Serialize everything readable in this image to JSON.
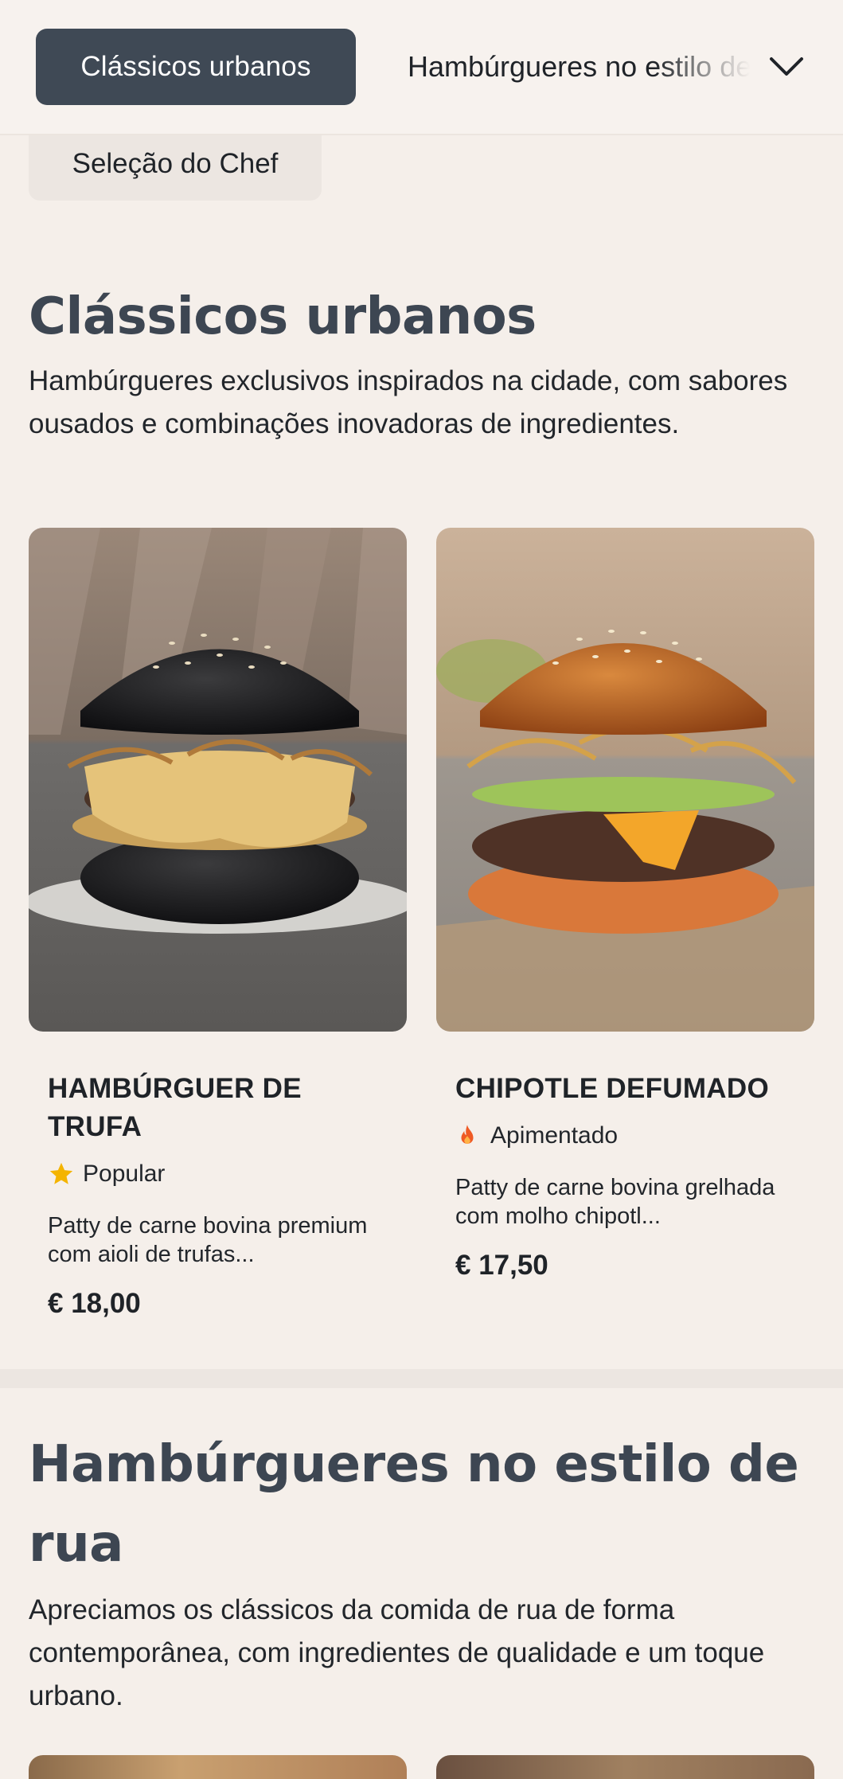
{
  "nav": {
    "active_tab": "Clássicos urbanos",
    "next_tab": "Hambúrgueres no estilo de rua",
    "second_row_tab": "Seleção do Chef"
  },
  "sections": [
    {
      "title": "Clássicos urbanos",
      "description": "Hambúrgueres exclusivos inspirados na cidade, com sabores ousados e combinações inovadoras de ingredientes.",
      "items": [
        {
          "name": "HAMBÚRGUER DE TRUFA",
          "tag": "Popular",
          "tag_icon": "star-icon",
          "description": "Patty de carne bovina premium com aioli de trufas...",
          "price": "€ 18,00"
        },
        {
          "name": "CHIPOTLE DEFUMADO",
          "tag": "Apimentado",
          "tag_icon": "flame-icon",
          "description": "Patty de carne bovina grelhada com molho chipotl...",
          "price": "€ 17,50"
        }
      ]
    },
    {
      "title": "Hambúrgueres no estilo de rua",
      "description": "Apreciamos os clássicos da comida de rua de forma contemporânea, com ingredientes de qualidade e um toque urbano."
    }
  ],
  "colors": {
    "background": "#f5efea",
    "active_pill": "#3f4955",
    "heading": "#3d4652",
    "star": "#f4b400",
    "flame": "#ef5a24"
  }
}
